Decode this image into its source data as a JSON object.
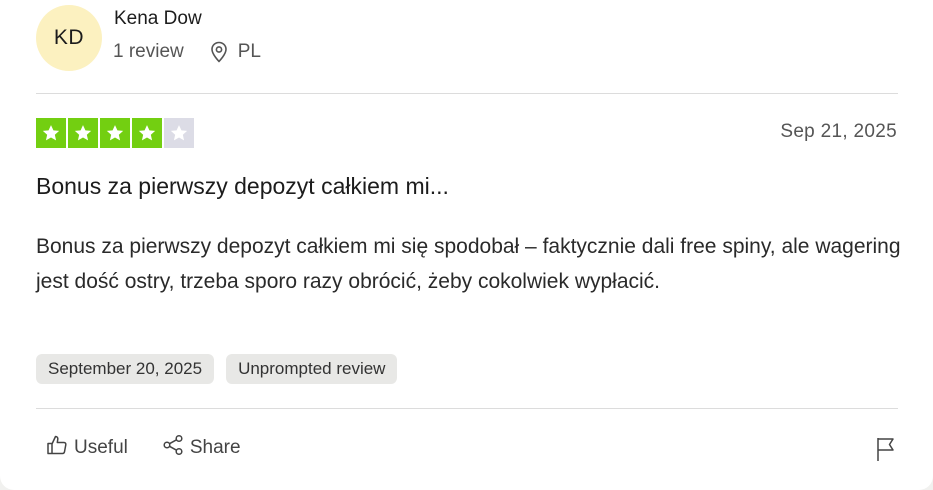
{
  "reviewer": {
    "initials": "KD",
    "name": "Kena Dow",
    "review_count": "1 review",
    "country": "PL",
    "avatar_color": "#fcf1c0"
  },
  "review": {
    "rating": 4,
    "rating_max": 5,
    "star_color": "#73cf11",
    "star_empty_color": "#dcdce6",
    "date": "Sep 21, 2025",
    "title": "Bonus za pierwszy depozyt całkiem mi...",
    "body": "Bonus za pierwszy depozyt całkiem mi się spodobał – faktycznie dali free spiny, ale wagering jest dość ostry, trzeba sporo razy obrócić, żeby cokolwiek wypłacić.",
    "tags": [
      "September 20, 2025",
      "Unprompted review"
    ]
  },
  "actions": {
    "useful_label": "Useful",
    "share_label": "Share",
    "icons": [
      "thumbs-up-icon",
      "share-icon",
      "flag-icon"
    ]
  }
}
